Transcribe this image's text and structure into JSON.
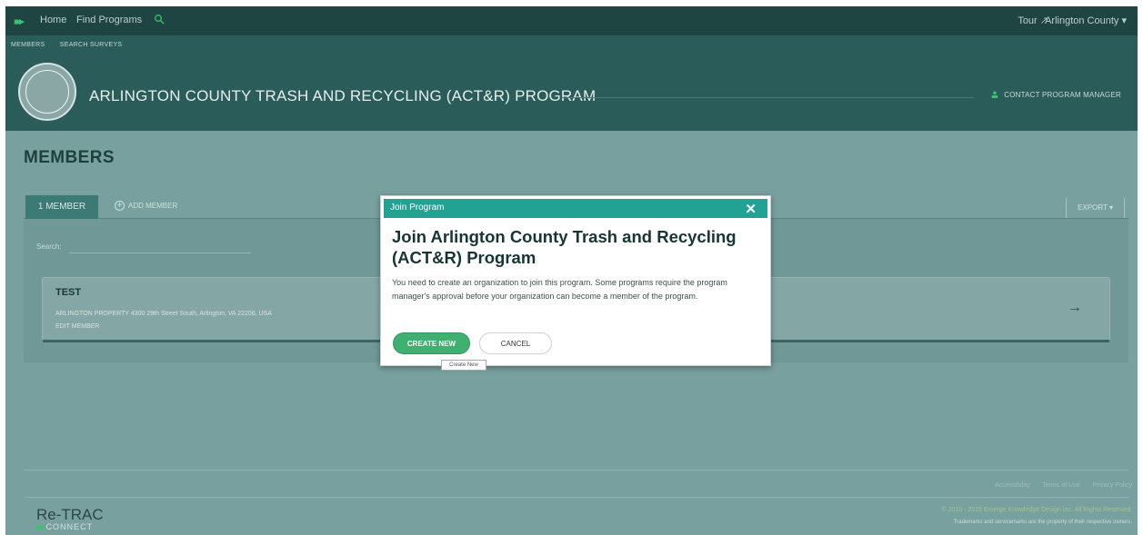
{
  "topnav": {
    "home": "Home",
    "find_programs": "Find Programs",
    "tour": "Tour",
    "account": "Arlington County"
  },
  "subnav": {
    "members": "MEMBERS",
    "search_surveys": "SEARCH SURVEYS"
  },
  "header": {
    "program_title": "ARLINGTON COUNTY TRASH AND RECYCLING (ACT&R) PROGRAM",
    "contact": "CONTACT PROGRAM MANAGER"
  },
  "main": {
    "title": "MEMBERS",
    "tab_member": "1 MEMBER",
    "add_member": "ADD MEMBER",
    "export": "EXPORT",
    "search_label": "Search:",
    "member": {
      "name": "TEST",
      "address": "ARLINGTON PROPERTY  4300 29th Street South, Arlington, VA 22206, USA",
      "edit": "EDIT MEMBER"
    }
  },
  "footer": {
    "links": [
      "Accessibility",
      "Terms of Use",
      "Privacy Policy"
    ],
    "logo": "Re-TRAC",
    "logo_sub": "CONNECT",
    "copyright": "© 2010 - 2016 Emerge Knowledge Design Inc. All Rights Reserved.",
    "trademark": "Trademarks and servicemarks are the property of their respective owners."
  },
  "modal": {
    "header": "Join Program",
    "title": "Join Arlington County Trash and Recycling (ACT&R) Program",
    "text": "You need to create an organization to join this program. Some programs require the program manager's approval before your organization can become a member of the program.",
    "create": "CREATE NEW",
    "cancel": "CANCEL",
    "tooltip": "Create New"
  },
  "colors": {
    "accent": "#21a292",
    "create_button": "#3fb070",
    "header_bg": "#2a5c59"
  }
}
